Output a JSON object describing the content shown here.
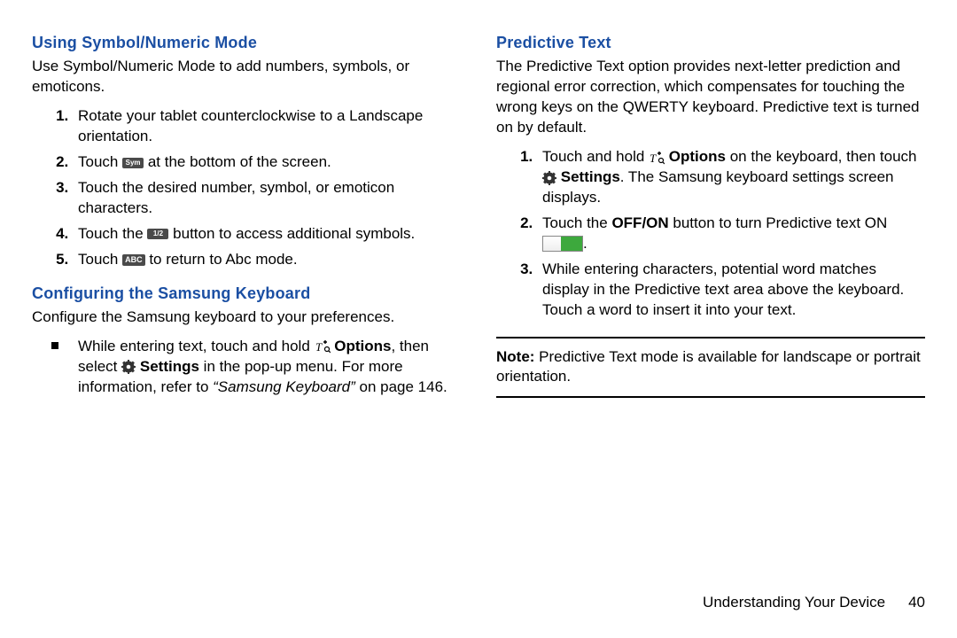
{
  "left": {
    "h1": "Using Symbol/Numeric Mode",
    "p1": "Use Symbol/Numeric Mode to add numbers, symbols, or emoticons.",
    "steps": {
      "s1": "Rotate your tablet counterclockwise to a Landscape orientation.",
      "s2_a": "Touch ",
      "s2_b": " at the bottom of the screen.",
      "s3": "Touch the desired number, symbol, or emoticon characters.",
      "s4_a": "Touch the ",
      "s4_b": " button to access additional symbols.",
      "s5_a": "Touch ",
      "s5_b": " to return to Abc mode."
    },
    "icon_sym": "Sym",
    "icon_half": "1/2",
    "icon_abc": "ABC",
    "h2": "Configuring the Samsung Keyboard",
    "p2": "Configure the Samsung keyboard to your preferences.",
    "bullet_a": "While entering text, touch and hold ",
    "bullet_opts": "Options",
    "bullet_b": ", then select ",
    "bullet_settings": "Settings",
    "bullet_c": " in the pop-up menu. ",
    "bullet_d": "For more information, refer to ",
    "bullet_ref": "“Samsung Keyboard”",
    "bullet_e": " on page 146."
  },
  "right": {
    "h1": "Predictive Text",
    "p1": "The Predictive Text option provides next-letter prediction and regional error correction, which compensates for touching the wrong keys on the QWERTY keyboard. Predictive text is turned on by default.",
    "s1_a": "Touch and hold ",
    "s1_opts": "Options",
    "s1_b": " on the keyboard, then touch ",
    "s1_settings": "Settings",
    "s1_c": ". The Samsung keyboard settings screen displays.",
    "s2_a": "Touch the ",
    "s2_offon": "OFF/ON",
    "s2_b": " button to turn Predictive text ON ",
    "s2_c": ".",
    "s3": "While entering characters, potential word matches display in the Predictive text area above the keyboard. Touch a word to insert it into your text.",
    "note_label": "Note:",
    "note_body": " Predictive Text mode is available for landscape or portrait orientation."
  },
  "footer": {
    "section": "Understanding Your Device",
    "page": "40"
  }
}
